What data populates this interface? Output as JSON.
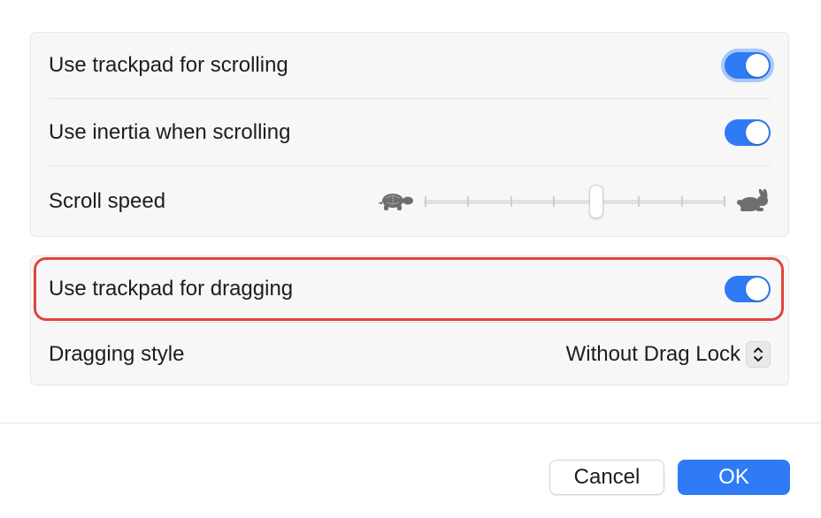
{
  "scrolling_group": {
    "trackpad_scrolling": {
      "label": "Use trackpad for scrolling",
      "enabled": true
    },
    "inertia_scrolling": {
      "label": "Use inertia when scrolling",
      "enabled": true
    },
    "scroll_speed": {
      "label": "Scroll speed",
      "slow_icon": "turtle-icon",
      "fast_icon": "rabbit-icon",
      "steps": 8,
      "value_step": 4
    }
  },
  "dragging_group": {
    "trackpad_dragging": {
      "label": "Use trackpad for dragging",
      "enabled": true
    },
    "dragging_style": {
      "label": "Dragging style",
      "value": "Without Drag Lock"
    }
  },
  "footer": {
    "cancel_label": "Cancel",
    "ok_label": "OK"
  },
  "colors": {
    "accent": "#2f7bf6",
    "highlight": "#e0453a"
  }
}
